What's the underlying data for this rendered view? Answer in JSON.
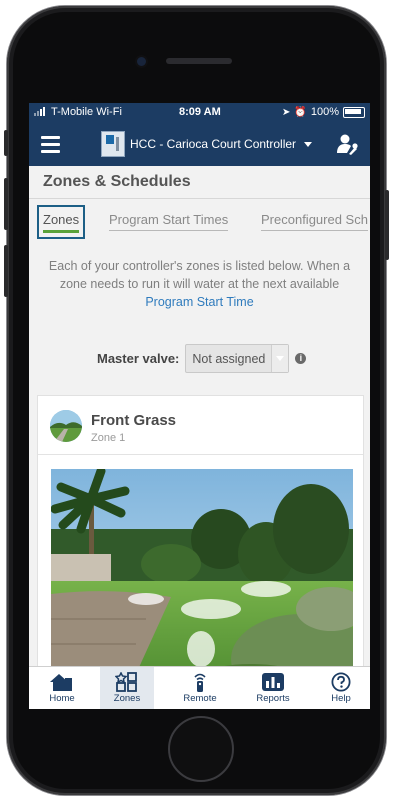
{
  "status_bar": {
    "carrier": "T-Mobile Wi-Fi",
    "time": "8:09 AM",
    "battery": "100%"
  },
  "nav": {
    "controller_name": "HCC - Carioca Court Controller"
  },
  "page": {
    "title": "Zones & Schedules"
  },
  "tabs": [
    {
      "label": "Zones",
      "active": true
    },
    {
      "label": "Program Start Times",
      "active": false
    },
    {
      "label": "Preconfigured Sch",
      "active": false
    }
  ],
  "description": {
    "text": "Each of your controller's zones is listed below. When a zone needs to run it will water at the next available",
    "link": "Program Start Time"
  },
  "master_valve": {
    "label": "Master valve:",
    "value": "Not assigned"
  },
  "zone_card": {
    "name": "Front Grass",
    "zone": "Zone 1"
  },
  "bottom_tabs": [
    {
      "label": "Home",
      "icon": "home-icon",
      "active": false
    },
    {
      "label": "Zones",
      "icon": "zones-icon",
      "active": true
    },
    {
      "label": "Remote",
      "icon": "remote-icon",
      "active": false
    },
    {
      "label": "Reports",
      "icon": "reports-icon",
      "active": false
    },
    {
      "label": "Help",
      "icon": "help-icon",
      "active": false
    }
  ],
  "colors": {
    "nav_bg": "#1c3c63",
    "active_tab_underline": "#5aa23a",
    "link": "#2f7bbd"
  }
}
